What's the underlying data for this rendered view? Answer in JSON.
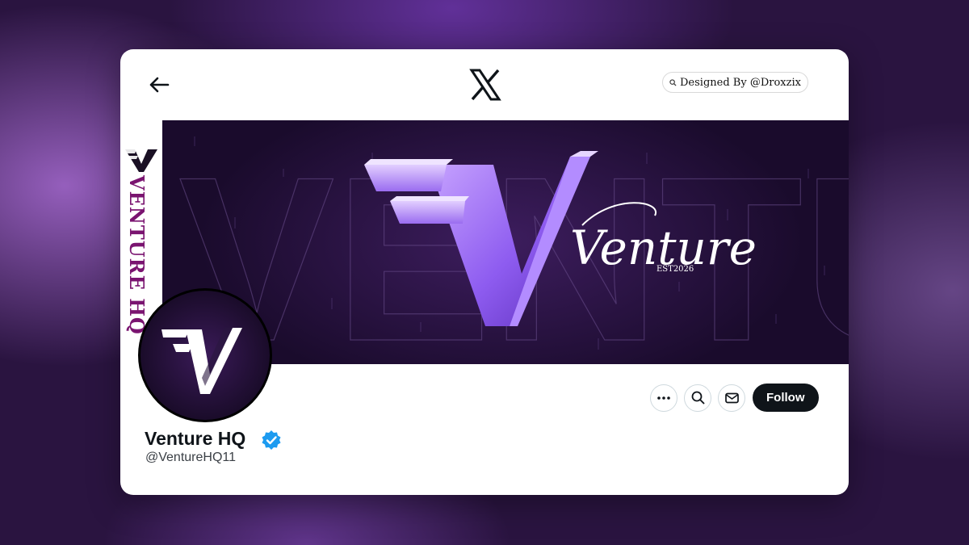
{
  "header": {
    "back_icon": "arrow-left-icon",
    "logo_icon": "x-logo-icon",
    "credit_label": "Designed By @Droxzix",
    "credit_icon": "search-icon"
  },
  "banner": {
    "watermark_text": "VENTURE HQ",
    "script_title": "Venture",
    "est_label": "EST2026",
    "side_brand": "VENTURE HQ"
  },
  "profile": {
    "display_name": "Venture HQ",
    "handle": "@VentureHQ11",
    "verified_icon": "verified-badge-icon",
    "verified_color": "#1d9bf0",
    "follow_label": "Follow",
    "more_icon": "more-icon",
    "search_icon": "search-icon",
    "message_icon": "mail-icon"
  },
  "colors": {
    "accent_purple": "#9a6cf0",
    "follow_bg": "#0f1419",
    "brand_magenta": "#7a1470"
  }
}
